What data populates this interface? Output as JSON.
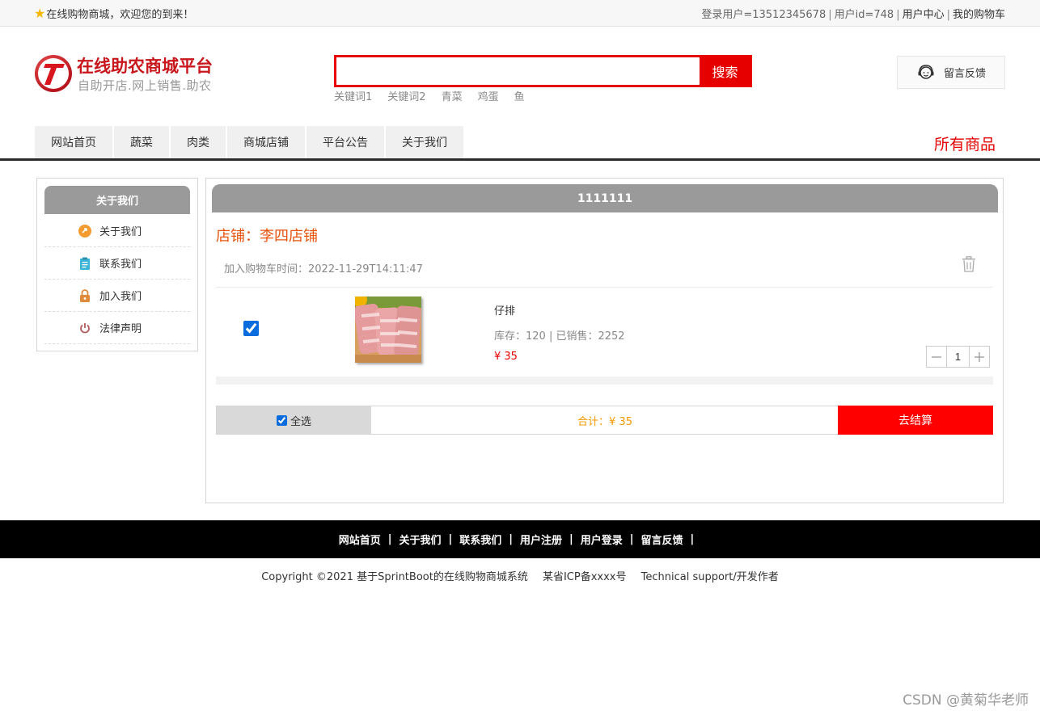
{
  "topbar": {
    "welcome": "在线购物商城，欢迎您的到来！",
    "login_user": "登录用户=13512345678",
    "user_id": "用户id=748",
    "user_center": "用户中心",
    "my_cart": "我的购物车"
  },
  "header": {
    "brand_title": "在线助农商城平台",
    "brand_subtitle": "自助开店.网上销售.助农",
    "search": {
      "value": "",
      "placeholder": "",
      "button_label": "搜索"
    },
    "hot_keywords": [
      "关键词1",
      "关键词2",
      "青菜",
      "鸡蛋",
      "鱼"
    ],
    "feedback_label": "留言反馈"
  },
  "nav": {
    "tabs": [
      "网站首页",
      "蔬菜",
      "肉类",
      "商城店铺",
      "平台公告",
      "关于我们"
    ],
    "all_goods": "所有商品"
  },
  "sidebar": {
    "title": "关于我们",
    "items": [
      {
        "label": "关于我们",
        "icon": "info-circle-icon",
        "color": "#f39b2f"
      },
      {
        "label": "联系我们",
        "icon": "clipboard-icon",
        "color": "#3bb3d6"
      },
      {
        "label": "加入我们",
        "icon": "lock-icon",
        "color": "#e08a3c"
      },
      {
        "label": "法律声明",
        "icon": "power-icon",
        "color": "#b05d5d"
      }
    ]
  },
  "cart": {
    "title": "1111111",
    "shop_name": "店铺：李四店铺",
    "added_time": "加入购物车时间：2022-11-29T14:11:47",
    "item": {
      "name": "仔排",
      "stock_sales": "库存：120 | 已销售：2252",
      "price": "¥ 35",
      "quantity": "1",
      "checked": true
    },
    "select_all_label": "全选",
    "total": "合计：¥ 35",
    "checkout_label": "去结算"
  },
  "footer": {
    "links": [
      "网站首页",
      "关于我们",
      "联系我们",
      "用户注册",
      "用户登录",
      "留言反馈"
    ],
    "copyright": "Copyright ©2021 基于SprintBoot的在线购物商城系统",
    "icp": "某省ICP备xxxx号",
    "support": "Technical support/开发作者"
  },
  "watermark": "CSDN @黄菊华老师",
  "colors": {
    "accent": "#e60000",
    "shop_orange": "#e8540e",
    "total_orange": "#f39800",
    "panel_grey": "#9a9a9a"
  }
}
